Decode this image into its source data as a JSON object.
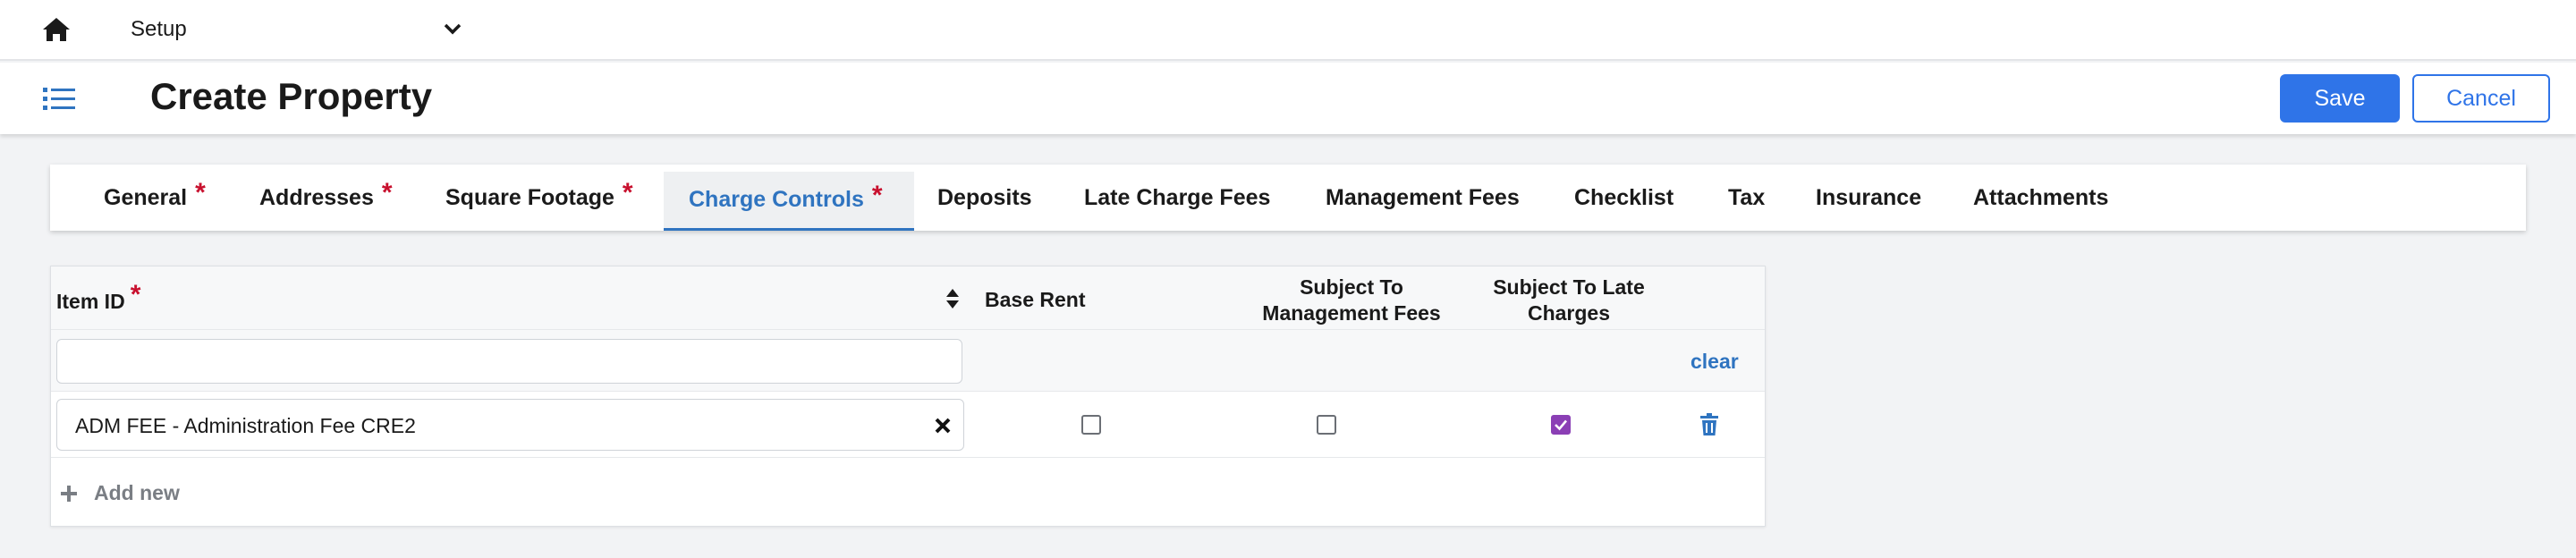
{
  "topbar": {
    "setup_label": "Setup",
    "home_icon": "home-icon",
    "chevron_icon": "chevron-down-icon"
  },
  "header": {
    "title": "Create Property",
    "save_label": "Save",
    "cancel_label": "Cancel",
    "menu_icon": "list-icon"
  },
  "tabs": [
    {
      "label": "General",
      "required": "*"
    },
    {
      "label": "Addresses",
      "required": "*"
    },
    {
      "label": "Square Footage",
      "required": "*"
    },
    {
      "label": "Charge Controls",
      "required": "*",
      "active": true
    },
    {
      "label": "Deposits"
    },
    {
      "label": "Late Charge Fees"
    },
    {
      "label": "Management Fees"
    },
    {
      "label": "Checklist"
    },
    {
      "label": "Tax"
    },
    {
      "label": "Insurance"
    },
    {
      "label": "Attachments"
    }
  ],
  "table": {
    "columns": {
      "item_id": "Item ID",
      "item_id_required": "*",
      "base_rent": "Base Rent",
      "mgmt_fees_line1": "Subject To",
      "mgmt_fees_line2": "Management Fees",
      "late_charges_line1": "Subject To Late",
      "late_charges_line2": "Charges"
    },
    "filter": {
      "value": "",
      "clear_label": "clear"
    },
    "rows": [
      {
        "item": "ADM FEE - Administration Fee CRE2",
        "base_rent": false,
        "subject_to_management_fees": false,
        "subject_to_late_charges": true
      }
    ],
    "add_new_label": "Add new"
  },
  "colors": {
    "accent": "#2f74e8",
    "link": "#2f74c0",
    "required": "#c8102e",
    "checked": "#8b3fb5"
  }
}
